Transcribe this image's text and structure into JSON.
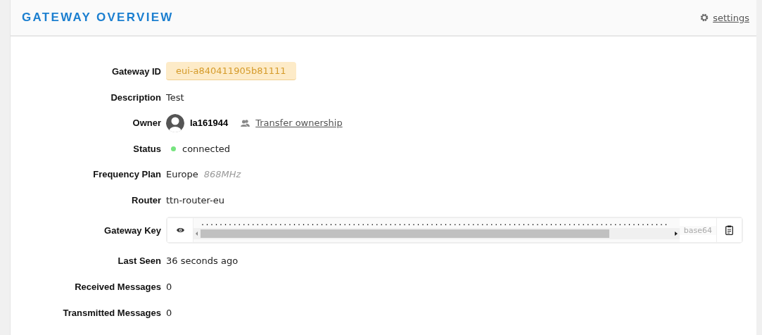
{
  "header": {
    "title": "GATEWAY OVERVIEW",
    "settings_link": "settings"
  },
  "rows": [
    {
      "kind": "badge",
      "label": "Gateway ID",
      "value": "eui-a840411905b81111"
    },
    {
      "kind": "text",
      "label": "Description",
      "value": "Test"
    },
    {
      "kind": "owner",
      "label": "Owner",
      "value": "la161944",
      "link": "Transfer ownership"
    },
    {
      "kind": "status",
      "label": "Status",
      "value": "connected",
      "online": true
    },
    {
      "kind": "frequency",
      "label": "Frequency Plan",
      "value": "Europe",
      "note": "868MHz"
    },
    {
      "kind": "text",
      "label": "Router",
      "value": "ttn-router-eu"
    },
    {
      "kind": "key",
      "label": "Gateway Key",
      "value": "......................................................................................................",
      "encoding": "base64"
    },
    {
      "kind": "text",
      "label": "Last Seen",
      "value": "36 seconds ago"
    },
    {
      "kind": "text",
      "label": "Received Messages",
      "value": "0"
    },
    {
      "kind": "text",
      "label": "Transmitted Messages",
      "value": "0"
    }
  ]
}
